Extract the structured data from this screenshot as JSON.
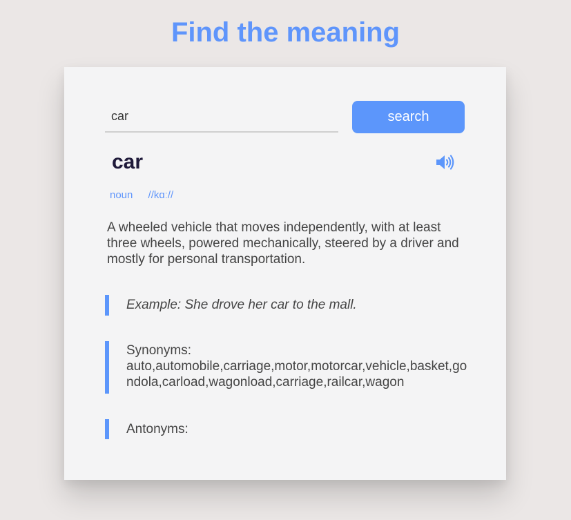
{
  "header": {
    "title": "Find the meaning"
  },
  "search": {
    "value": "car",
    "button_label": "search"
  },
  "result": {
    "word": "car",
    "part_of_speech": "noun",
    "pronunciation": "//kɑː//",
    "definition": "A wheeled vehicle that moves independently, with at least three wheels, powered mechanically, steered by a driver and mostly for personal transportation.",
    "example": "Example: She drove her car to the mall.",
    "synonyms_label": "Synonyms:",
    "synonyms": "auto,automobile,carriage,motor,motorcar,vehicle,basket,gondola,carload,wagonload,carriage,railcar,wagon",
    "antonyms_label": "Antonyms:",
    "antonyms": ""
  },
  "icons": {
    "speaker": "speaker-icon"
  },
  "colors": {
    "accent": "#5c96fb",
    "title": "#5f95fb",
    "word": "#1f1a3a",
    "background": "#ebe7e6",
    "card": "#f4f4f5"
  }
}
